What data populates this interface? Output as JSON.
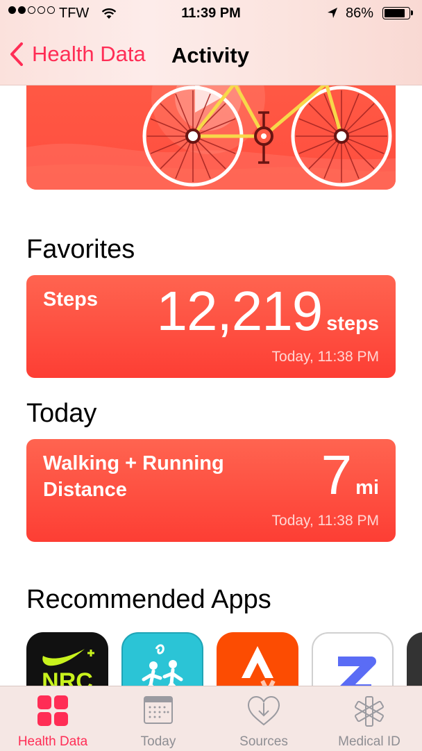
{
  "status_bar": {
    "carrier": "TFW",
    "time": "11:39 PM",
    "battery": "86%",
    "battery_level": 0.86
  },
  "nav": {
    "back_label": "Health Data",
    "title": "Activity"
  },
  "sections": {
    "favorites_title": "Favorites",
    "today_title": "Today",
    "recommended_title": "Recommended Apps"
  },
  "favorites": {
    "label": "Steps",
    "value": "12,219",
    "unit": "steps",
    "timestamp": "Today, 11:38 PM"
  },
  "today": {
    "label_line1": "Walking + Running",
    "label_line2": "Distance",
    "value": "7",
    "unit": "mi",
    "timestamp": "Today, 11:38 PM"
  },
  "recommended_apps": [
    {
      "icon": "nike-run-club-icon",
      "text": "NRC"
    },
    {
      "icon": "runkeeper-icon"
    },
    {
      "icon": "strava-icon"
    },
    {
      "icon": "zova-icon"
    },
    {
      "icon": "app-icon"
    }
  ],
  "tabbar": {
    "tabs": [
      {
        "label": "Health Data",
        "icon": "health-data-icon",
        "active": true
      },
      {
        "label": "Today",
        "icon": "calendar-icon",
        "active": false
      },
      {
        "label": "Sources",
        "icon": "sources-icon",
        "active": false
      },
      {
        "label": "Medical ID",
        "icon": "medical-id-icon",
        "active": false
      }
    ]
  },
  "colors": {
    "accent": "#ff2d55",
    "activity_card": "#fd4a3c"
  }
}
